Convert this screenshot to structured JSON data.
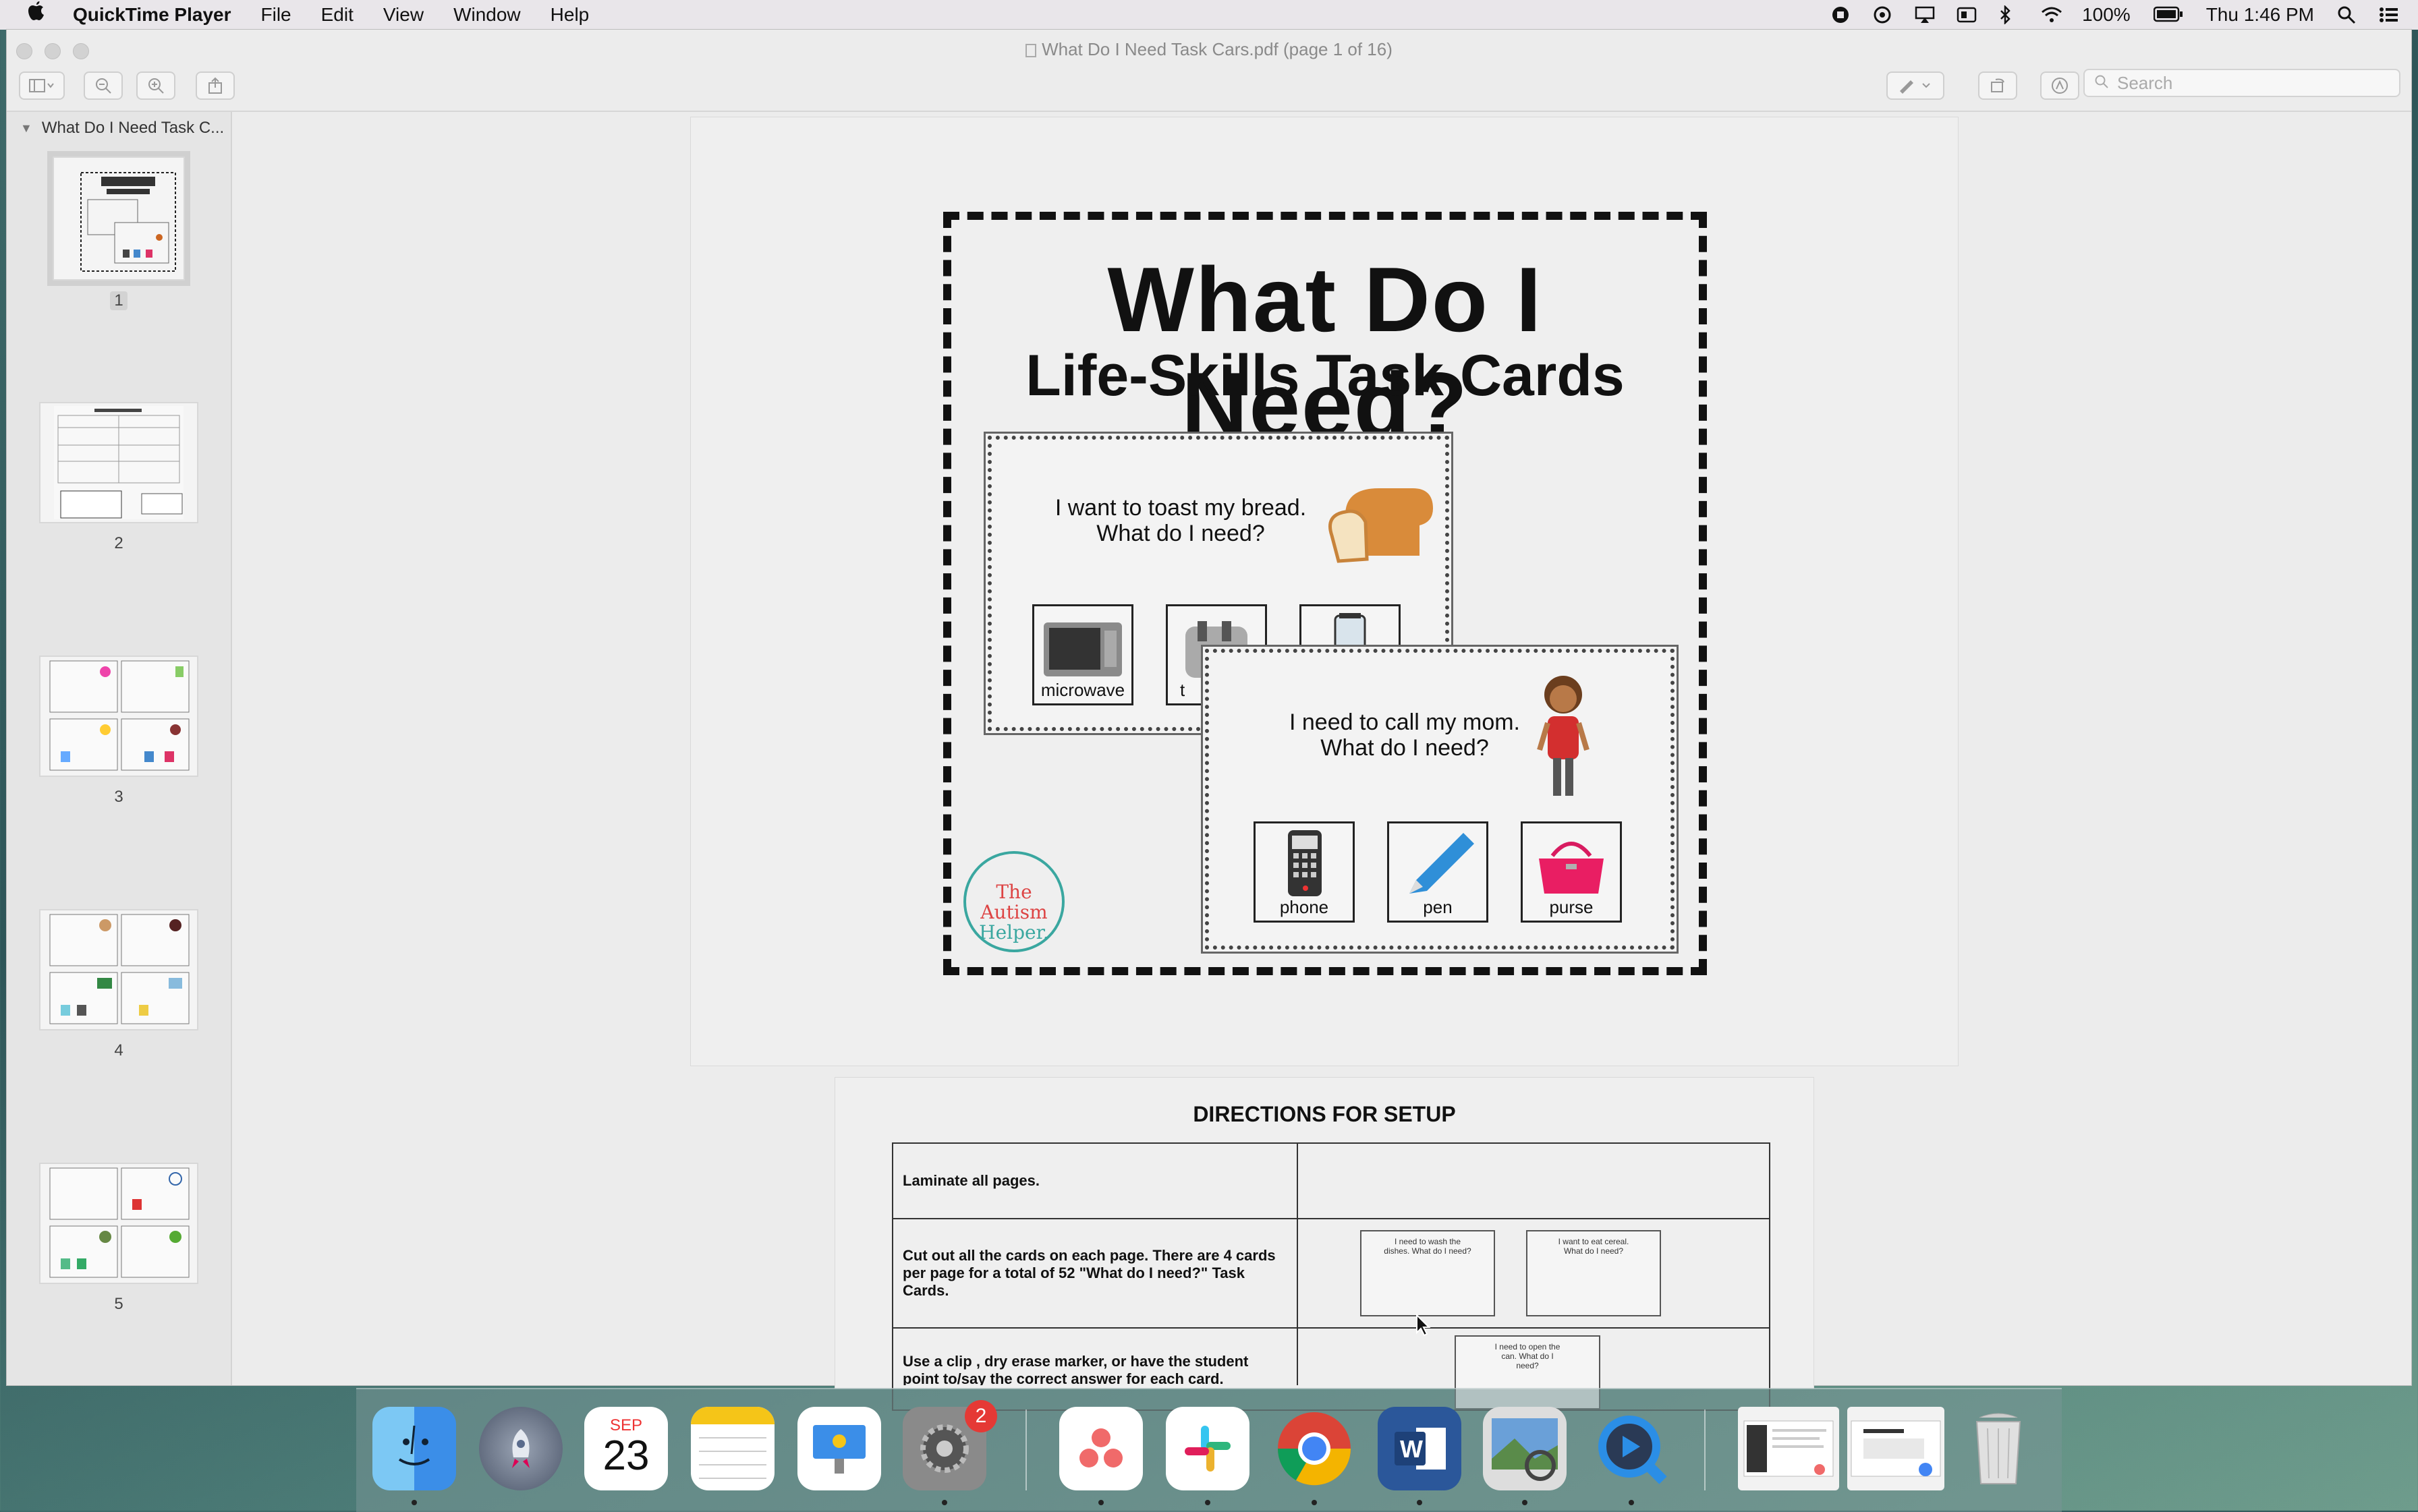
{
  "menubar": {
    "app_name": "QuickTime Player",
    "menus": [
      "File",
      "Edit",
      "View",
      "Window",
      "Help"
    ],
    "battery": "100%",
    "clock": "Thu 1:46 PM"
  },
  "window": {
    "title": "What Do I Need Task Cars.pdf (page 1 of 16)",
    "search_placeholder": "Search"
  },
  "sidebar": {
    "doc_name": "What Do I Need Task C...",
    "pages": [
      "1",
      "2",
      "3",
      "4",
      "5"
    ]
  },
  "cover": {
    "title": "What Do I Need?",
    "subtitle": "Life-Skills Task Cards",
    "card1": {
      "line1": "I want to toast my bread.",
      "line2": "What do I need?",
      "choices": [
        "microwave",
        "t"
      ]
    },
    "card2": {
      "line1": "I need to call my mom.",
      "line2": "What do I need?",
      "choices": [
        "phone",
        "pen",
        "purse"
      ]
    },
    "logo_line1": "The Autism",
    "logo_line2": "Helper."
  },
  "directions": {
    "title": "DIRECTIONS FOR SETUP",
    "rows": [
      "Laminate all pages.",
      "Cut out all the cards on each page.  There are 4 cards per page for a total of 52 \"What do I need?\" Task Cards.",
      "Use a clip , dry erase marker, or have the student point to/say the correct answer for each card."
    ],
    "mini_cards": [
      "I need to wash the dishes. What do I need?",
      "I want to eat cereal. What do I need?",
      "I need to open the can. What do I need?"
    ]
  },
  "dock": {
    "calendar_month": "SEP",
    "calendar_day": "23",
    "settings_badge": "2"
  }
}
